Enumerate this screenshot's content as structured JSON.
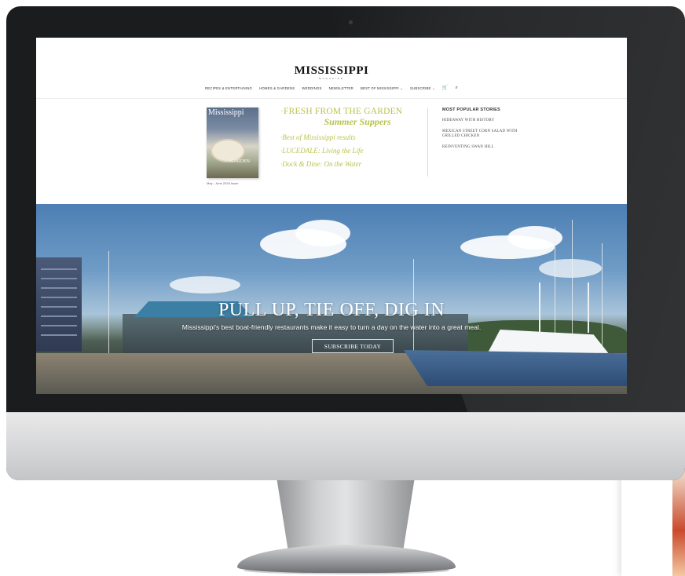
{
  "site": {
    "logo": "MISSISSIPPI",
    "logo_sub": "MAGAZINE",
    "nav": [
      "RECIPES & ENTERTAINING",
      "HOMES & GARDENS",
      "WEDDINGS",
      "NEWSLETTER",
      "BEST OF MISSISSIPPI ⌄",
      "SUBSCRIBE ⌄"
    ],
    "cart_icon": "🛒",
    "search_icon": "⌕"
  },
  "issue": {
    "cover_title": "Mississippi",
    "cover_tag": "GARDEN",
    "caption": "May - June 2026 Issue",
    "headline": "·FRESH FROM THE GARDEN",
    "subhead": "Summer Suppers",
    "items": [
      "·Best of Mississippi results",
      "·LUCEDALE: Living the Life",
      "·Dock & Dine: On the Water"
    ]
  },
  "popular": {
    "heading": "MOST POPULAR STORIES",
    "stories": [
      "HIDEAWAY WITH HISTORY",
      "MEXICAN STREET CORN SALAD WITH GRILLED CHICKEN",
      "REINVENTING SWAN HILL"
    ]
  },
  "hero": {
    "title": "PULL UP, TIE OFF, DIG IN",
    "subtitle": "Mississippi's best boat-friendly restaurants make it easy to turn a day on the water into a great meal.",
    "button": "SUBSCRIBE TODAY"
  },
  "colors": {
    "accent_green": "#b9c24d",
    "teal": "#4f96a3",
    "monitor_bezel": "#1b1c1e"
  }
}
